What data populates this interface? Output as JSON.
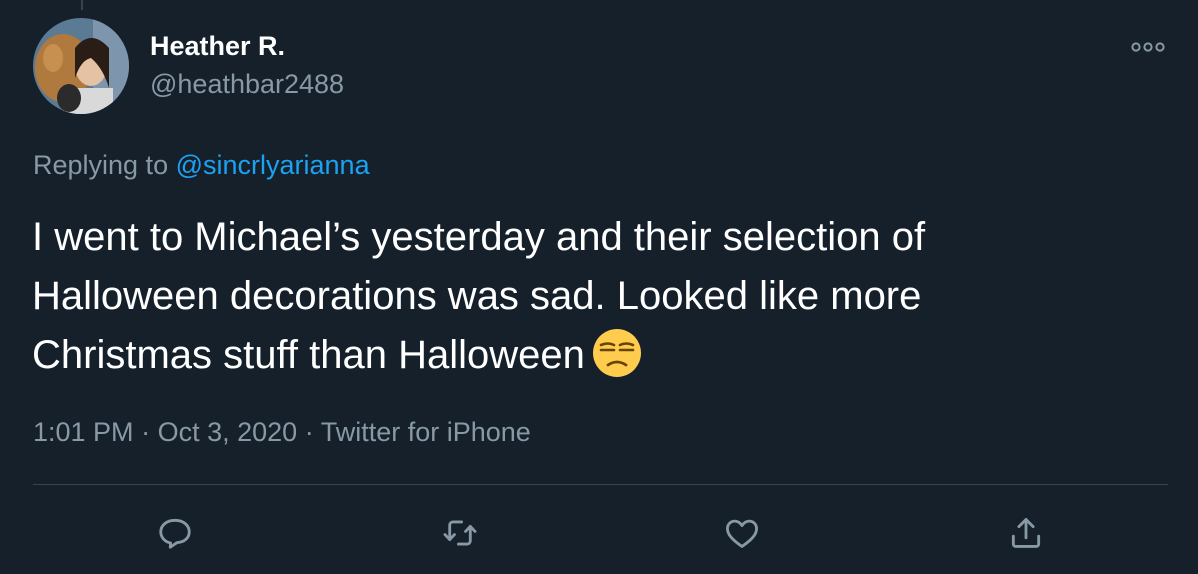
{
  "tweet": {
    "author": {
      "display_name": "Heather R.",
      "handle": "@heathbar2488",
      "avatar_icon": "avatar-photo"
    },
    "more_icon": "more-options-icon",
    "reply_context": {
      "prefix": "Replying to",
      "mention": "@sincrlyarianna"
    },
    "text_lines": [
      "I went to Michael’s yesterday and their selection of",
      "Halloween decorations was sad. Looked like more",
      "Christmas stuff than Halloween"
    ],
    "emoji": "unamused-face-emoji",
    "time": "1:01 PM",
    "date": "Oct 3, 2020",
    "source": "Twitter for iPhone",
    "separator": "·",
    "actions": [
      {
        "name": "reply",
        "icon": "reply-icon"
      },
      {
        "name": "retweet",
        "icon": "retweet-icon"
      },
      {
        "name": "like",
        "icon": "heart-icon"
      },
      {
        "name": "share",
        "icon": "share-icon"
      }
    ]
  },
  "colors": {
    "background": "#15202b",
    "primary_text": "#ffffff",
    "secondary_text": "#8899a6",
    "accent": "#1da1f2",
    "divider": "#38444d"
  }
}
